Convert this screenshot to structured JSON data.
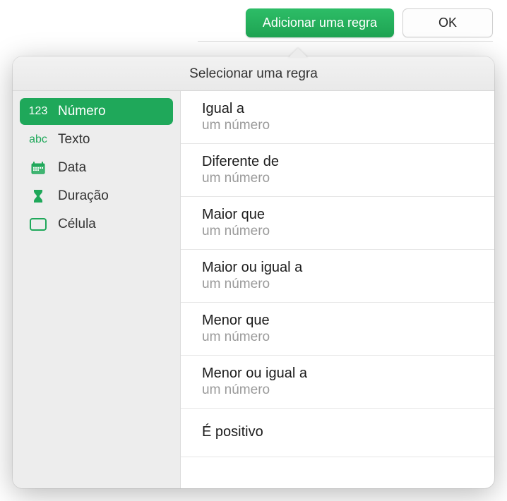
{
  "toolbar": {
    "add_rule_label": "Adicionar uma regra",
    "ok_label": "OK"
  },
  "popover": {
    "title": "Selecionar uma regra"
  },
  "sidebar": {
    "items": [
      {
        "icon": "123",
        "label": "Número",
        "active": true
      },
      {
        "icon": "abc",
        "label": "Texto",
        "active": false
      },
      {
        "icon": "calendar",
        "label": "Data",
        "active": false
      },
      {
        "icon": "hourglass",
        "label": "Duração",
        "active": false
      },
      {
        "icon": "cell",
        "label": "Célula",
        "active": false
      }
    ]
  },
  "rules": [
    {
      "title": "Igual a",
      "subtitle": "um número"
    },
    {
      "title": "Diferente de",
      "subtitle": "um número"
    },
    {
      "title": "Maior que",
      "subtitle": "um número"
    },
    {
      "title": "Maior ou igual a",
      "subtitle": "um número"
    },
    {
      "title": "Menor que",
      "subtitle": "um número"
    },
    {
      "title": "Menor ou igual a",
      "subtitle": "um número"
    },
    {
      "title": "É positivo",
      "subtitle": ""
    }
  ]
}
